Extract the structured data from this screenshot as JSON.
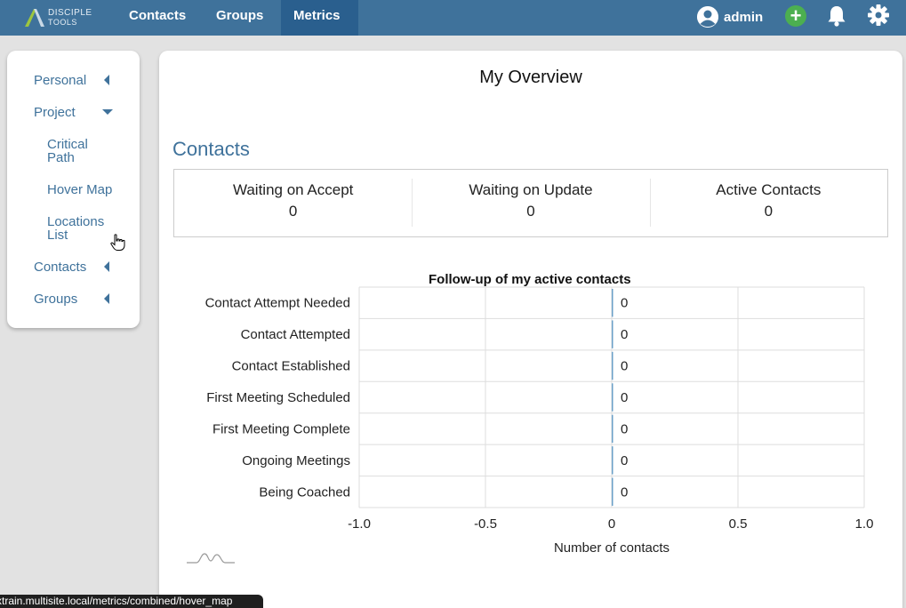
{
  "logo": {
    "line1": "DISCIPLE",
    "line2": "TOOLS"
  },
  "nav": {
    "items": [
      {
        "label": "Contacts"
      },
      {
        "label": "Groups"
      },
      {
        "label": "Metrics"
      }
    ]
  },
  "user": {
    "name": "admin"
  },
  "sidebar": {
    "personal": "Personal",
    "project": "Project",
    "critical_path": "Critical Path",
    "hover_map": "Hover Map",
    "locations_list": "Locations List",
    "contacts": "Contacts",
    "groups": "Groups"
  },
  "main": {
    "title": "My Overview",
    "section_title": "Contacts",
    "stats": [
      {
        "label": "Waiting on Accept",
        "value": "0"
      },
      {
        "label": "Waiting on Update",
        "value": "0"
      },
      {
        "label": "Active Contacts",
        "value": "0"
      }
    ]
  },
  "chart_data": {
    "type": "bar",
    "orientation": "horizontal",
    "title": "Follow-up of my active contacts",
    "xlabel": "Number of contacts",
    "ylabel": "",
    "xlim": [
      -1.0,
      1.0
    ],
    "xticks": [
      "-1.0",
      "-0.5",
      "0",
      "0.5",
      "1.0"
    ],
    "categories": [
      "Contact Attempt Needed",
      "Contact Attempted",
      "Contact Established",
      "First Meeting Scheduled",
      "First Meeting Complete",
      "Ongoing Meetings",
      "Being Coached"
    ],
    "values": [
      0,
      0,
      0,
      0,
      0,
      0,
      0
    ],
    "bar_color": "#6a9fc7",
    "grid": true
  },
  "statusbar": {
    "url": "xtrain.multisite.local/metrics/combined/hover_map"
  }
}
